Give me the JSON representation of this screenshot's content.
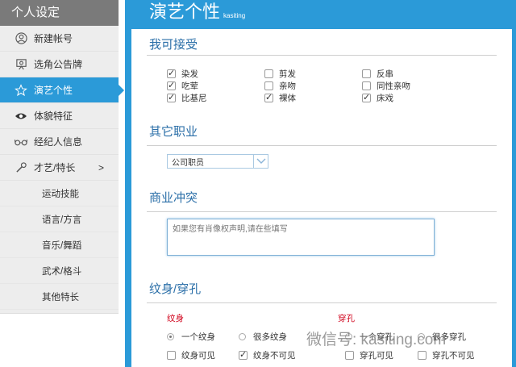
{
  "sidebar": {
    "title": "个人设定",
    "items": [
      {
        "label": "新建帐号",
        "icon": "user-circle-icon"
      },
      {
        "label": "选角公告牌",
        "icon": "billboard-icon"
      },
      {
        "label": "演艺个性",
        "icon": "star-icon"
      },
      {
        "label": "体貌特征",
        "icon": "eye-icon"
      },
      {
        "label": "经纪人信息",
        "icon": "glasses-icon"
      },
      {
        "label": "才艺/特长",
        "icon": "microphone-icon",
        "chevron": ">"
      }
    ],
    "subitems": [
      "运动技能",
      "语言/方言",
      "音乐/舞蹈",
      "武术/格斗",
      "其他特长"
    ]
  },
  "header": {
    "title": "演艺个性",
    "subtitle": "kasiting"
  },
  "accept": {
    "title": "我可接受",
    "options": [
      {
        "label": "染发",
        "checked": true
      },
      {
        "label": "剪发",
        "checked": false
      },
      {
        "label": "反串",
        "checked": false
      },
      {
        "label": "吃荤",
        "checked": true
      },
      {
        "label": "亲吻",
        "checked": false
      },
      {
        "label": "同性亲吻",
        "checked": false
      },
      {
        "label": "比基尼",
        "checked": true
      },
      {
        "label": "裸体",
        "checked": true
      },
      {
        "label": "床戏",
        "checked": true
      }
    ]
  },
  "other_job": {
    "title": "其它职业",
    "selected": "公司职员"
  },
  "conflict": {
    "title": "商业冲突",
    "placeholder": "如果您有肖像权声明,请在些填写"
  },
  "tattoo": {
    "title": "纹身/穿孔",
    "tattoo_label": "纹身",
    "piercing_label": "穿孔",
    "radios": [
      {
        "label": "一个纹身",
        "selected": true
      },
      {
        "label": "很多纹身",
        "selected": false
      },
      {
        "label": "一个穿孔",
        "selected": false
      },
      {
        "label": "很多穿孔",
        "selected": false
      }
    ],
    "visibility": [
      {
        "label": "纹身可见",
        "checked": false
      },
      {
        "label": "纹身不可见",
        "checked": true
      },
      {
        "label": "穿孔可见",
        "checked": false
      },
      {
        "label": "穿孔不可见",
        "checked": false
      }
    ]
  },
  "watermark": "微信号: kasiting.com",
  "colors": {
    "accent": "#2b9ad8",
    "heading": "#2b6fa8",
    "alert": "#d0021b"
  }
}
